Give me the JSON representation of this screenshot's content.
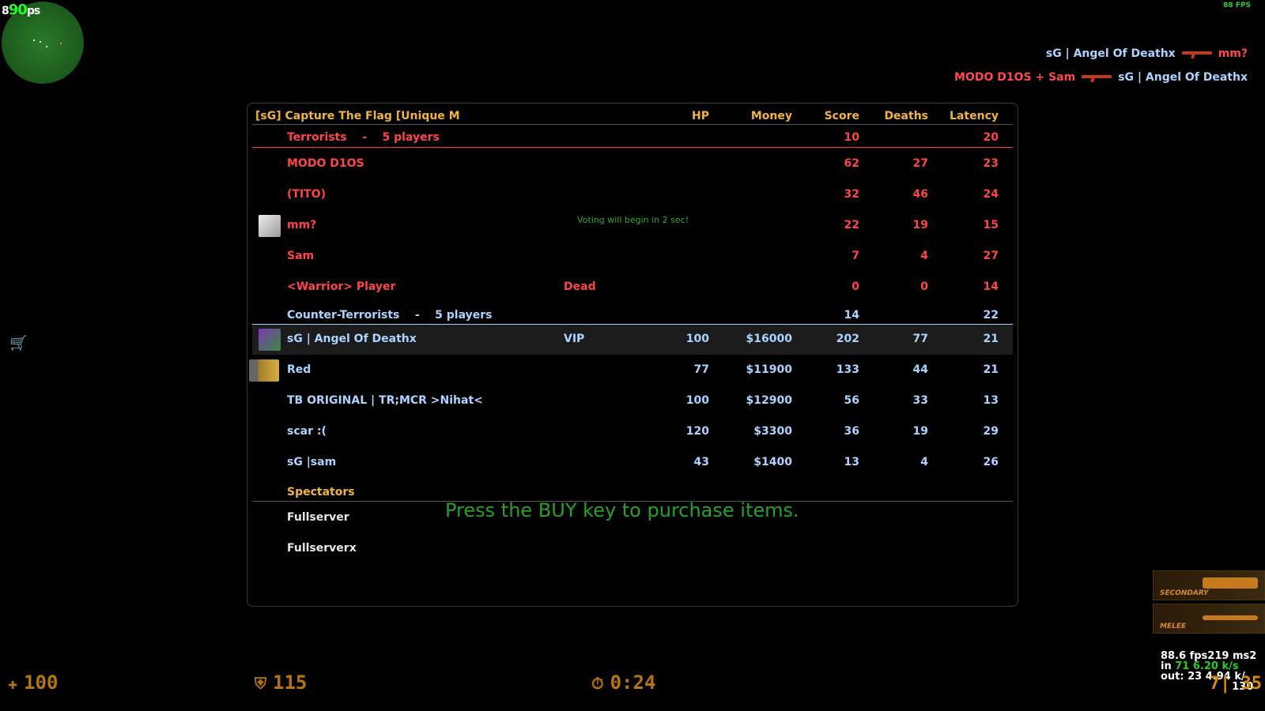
{
  "hud_top": {
    "fps_overlay": "8",
    "fps_overlay_big": "90",
    "fps_overlay_suffix": "ps",
    "fps_corner": "88 FPS"
  },
  "killfeed": [
    {
      "killer": "sG | Angel Of Deathx",
      "killer_team": "ct",
      "weapon_icon": "ak47-icon",
      "victim": "mm?",
      "victim_team": "t"
    },
    {
      "killer": "MODO D1OS + Sam",
      "killer_team": "t",
      "weapon_icon": "ak47-icon",
      "victim": "sG | Angel Of Deathx",
      "victim_team": "ct"
    }
  ],
  "scoreboard": {
    "server_name": "[sG] Capture The Flag [Unique M",
    "columns": {
      "hp": "HP",
      "money": "Money",
      "score": "Score",
      "deaths": "Deaths",
      "latency": "Latency"
    },
    "terrorists": {
      "label": "Terrorists",
      "sep": "-",
      "count": "5 players",
      "score": "10",
      "latency": "20",
      "players": [
        {
          "name": "MODO D1OS",
          "tag": "",
          "hp": "",
          "money": "",
          "score": "62",
          "deaths": "27",
          "latency": "23"
        },
        {
          "name": "(TITO)",
          "tag": "",
          "hp": "",
          "money": "",
          "score": "32",
          "deaths": "46",
          "latency": "24"
        },
        {
          "name": "mm?",
          "tag": "",
          "hp": "",
          "money": "",
          "score": "22",
          "deaths": "19",
          "latency": "15"
        },
        {
          "name": "Sam",
          "tag": "",
          "hp": "",
          "money": "",
          "score": "7",
          "deaths": "4",
          "latency": "27"
        },
        {
          "name": "<Warrior> Player",
          "tag": "Dead",
          "hp": "",
          "money": "",
          "score": "0",
          "deaths": "0",
          "latency": "14"
        }
      ]
    },
    "counter_terrorists": {
      "label": "Counter-Terrorists",
      "sep": "-",
      "count": "5 players",
      "score": "14",
      "latency": "22",
      "players": [
        {
          "name": "sG | Angel Of Deathx",
          "tag": "VIP",
          "hp": "100",
          "money": "$16000",
          "score": "202",
          "deaths": "77",
          "latency": "21"
        },
        {
          "name": "Red",
          "tag": "",
          "hp": "77",
          "money": "$11900",
          "score": "133",
          "deaths": "44",
          "latency": "21"
        },
        {
          "name": "TB ORIGINAL | TR;MCR >Nihat<",
          "tag": "",
          "hp": "100",
          "money": "$12900",
          "score": "56",
          "deaths": "33",
          "latency": "13"
        },
        {
          "name": "scar :(",
          "tag": "",
          "hp": "120",
          "money": "$3300",
          "score": "36",
          "deaths": "19",
          "latency": "29"
        },
        {
          "name": "sG |sam",
          "tag": "",
          "hp": "43",
          "money": "$1400",
          "score": "13",
          "deaths": "4",
          "latency": "26"
        }
      ]
    },
    "spectators": {
      "label": "Spectators",
      "players": [
        "Fullserver",
        "Fullserverx"
      ]
    }
  },
  "messages": {
    "vote": "Voting will begin in 2 sec!",
    "buy": "Press the BUY key to purchase items."
  },
  "weapons": {
    "secondary": "SECONDARY",
    "melee": "MELEE"
  },
  "netgraph": {
    "line1": "88.6 fps219 ms2",
    "line2_a": "in ",
    "line2_b": "71 6.20 k/s",
    "line3_a": "out: ",
    "line3_b": "23 4.94 k/",
    "line4": "130"
  },
  "hud_bottom": {
    "health": "100",
    "armor": "115",
    "timer": "0:24",
    "ammo": "7| 35"
  },
  "colors": {
    "terrorist": "#ff4646",
    "counter_terrorist": "#aad4ff",
    "header": "#f2b53a",
    "hud": "#d88a10"
  }
}
